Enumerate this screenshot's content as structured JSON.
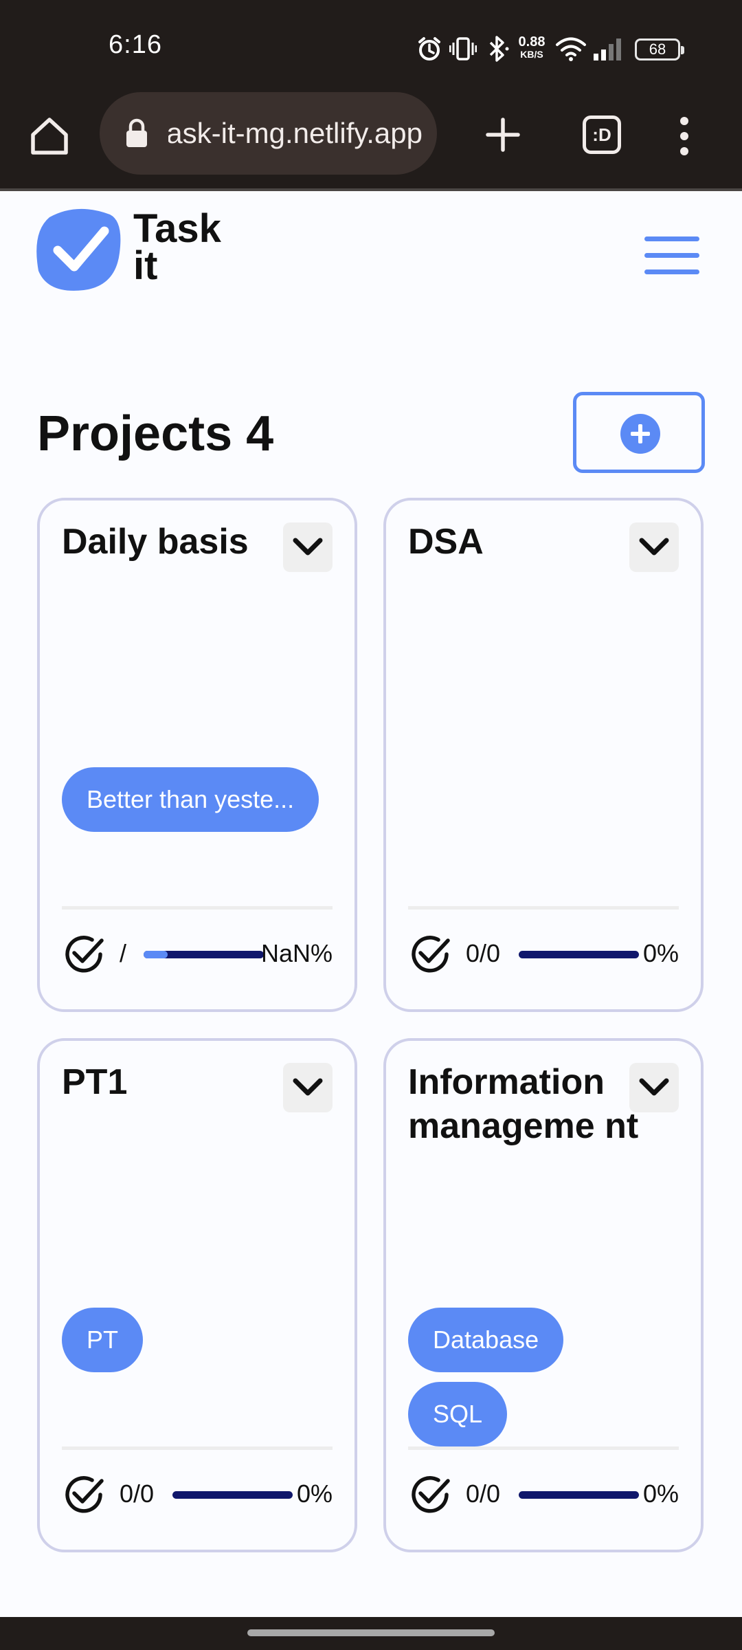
{
  "status_bar": {
    "time": "6:16",
    "net_speed_value": "0.88",
    "net_speed_unit": "KB/S",
    "battery": "68"
  },
  "browser": {
    "url": "task-it-mg.netlify.app",
    "tab_count_label": ":D"
  },
  "app": {
    "logo_line1": "Task",
    "logo_line2": "it",
    "accent_color": "#5b8af5",
    "bar_color": "#10176b"
  },
  "projects": {
    "title": "Projects 4",
    "cards": [
      {
        "title": "Daily basis",
        "tags": [
          "Better than yeste..."
        ],
        "count": "/",
        "percent": "NaN%",
        "progress": 0.2
      },
      {
        "title": "DSA",
        "tags": [],
        "count": "0/0",
        "percent": "0%",
        "progress": 0
      },
      {
        "title": "PT1",
        "tags": [
          "PT"
        ],
        "count": "0/0",
        "percent": "0%",
        "progress": 0
      },
      {
        "title": "Information manageme nt",
        "tags": [
          "Database",
          "SQL"
        ],
        "count": "0/0",
        "percent": "0%",
        "progress": 0
      }
    ]
  }
}
